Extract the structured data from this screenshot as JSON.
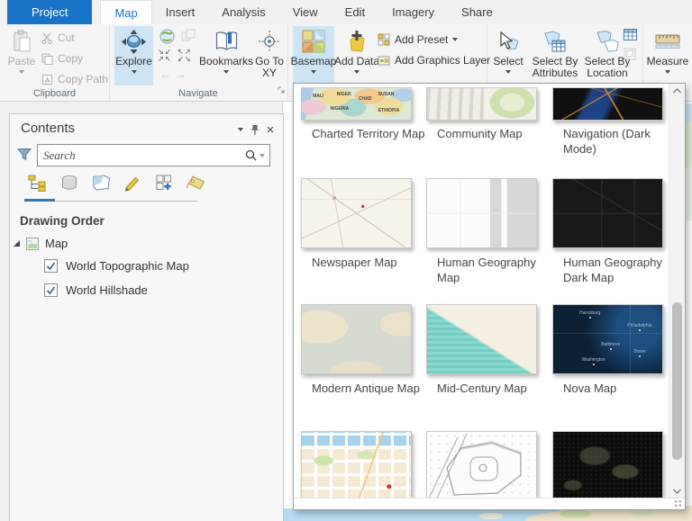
{
  "tabs": [
    {
      "label": "Project",
      "state": "accent"
    },
    {
      "label": "Map",
      "state": "active"
    },
    {
      "label": "Insert"
    },
    {
      "label": "Analysis"
    },
    {
      "label": "View"
    },
    {
      "label": "Edit"
    },
    {
      "label": "Imagery"
    },
    {
      "label": "Share"
    }
  ],
  "ribbon": {
    "clipboard": {
      "group_label": "Clipboard",
      "paste": "Paste",
      "cut": "Cut",
      "copy": "Copy",
      "copy_path": "Copy Path"
    },
    "navigate": {
      "group_label": "Navigate",
      "explore": "Explore",
      "bookmarks": "Bookmarks",
      "go_to_xy": "Go To XY"
    },
    "layer": {
      "basemap": "Basemap",
      "add_data": "Add Data",
      "add_preset": "Add Preset",
      "add_graphics_layer": "Add Graphics Layer"
    },
    "selection": {
      "select": "Select",
      "select_by_attributes": "Select By Attributes",
      "select_by_location": "Select By Location"
    },
    "measure": {
      "label": "Measure"
    }
  },
  "contents_panel": {
    "title": "Contents",
    "search_placeholder": "Search",
    "section_heading": "Drawing Order",
    "map_item": "Map",
    "layers": [
      {
        "label": "World Topographic Map",
        "checked": true
      },
      {
        "label": "World Hillshade",
        "checked": true
      }
    ]
  },
  "basemap_gallery": {
    "items": [
      {
        "label": "Charted Territory Map"
      },
      {
        "label": "Community Map"
      },
      {
        "label": "Navigation (Dark Mode)"
      },
      {
        "label": "Newspaper Map"
      },
      {
        "label": "Human Geography Map"
      },
      {
        "label": "Human Geography Dark Map"
      },
      {
        "label": "Modern Antique Map"
      },
      {
        "label": "Mid-Century Map"
      },
      {
        "label": "Nova Map"
      },
      {
        "label": ""
      },
      {
        "label": ""
      },
      {
        "label": ""
      }
    ],
    "charted_territory_labels": [
      "MALI",
      "NIGER",
      "CHAD",
      "SUDAN",
      "NIGERIA",
      "ETHIOPIA"
    ],
    "nova_map_labels": [
      "Harrisburg",
      "Philadelphia",
      "Baltimore",
      "Washington",
      "Dover"
    ]
  },
  "colors": {
    "accent_blue": "#1973c8",
    "ribbon_highlight": "#cde4f4",
    "water_blue": "#b7dbf0",
    "nova_navy": "#0c2036",
    "midcentury_teal": "#74cdc5"
  }
}
